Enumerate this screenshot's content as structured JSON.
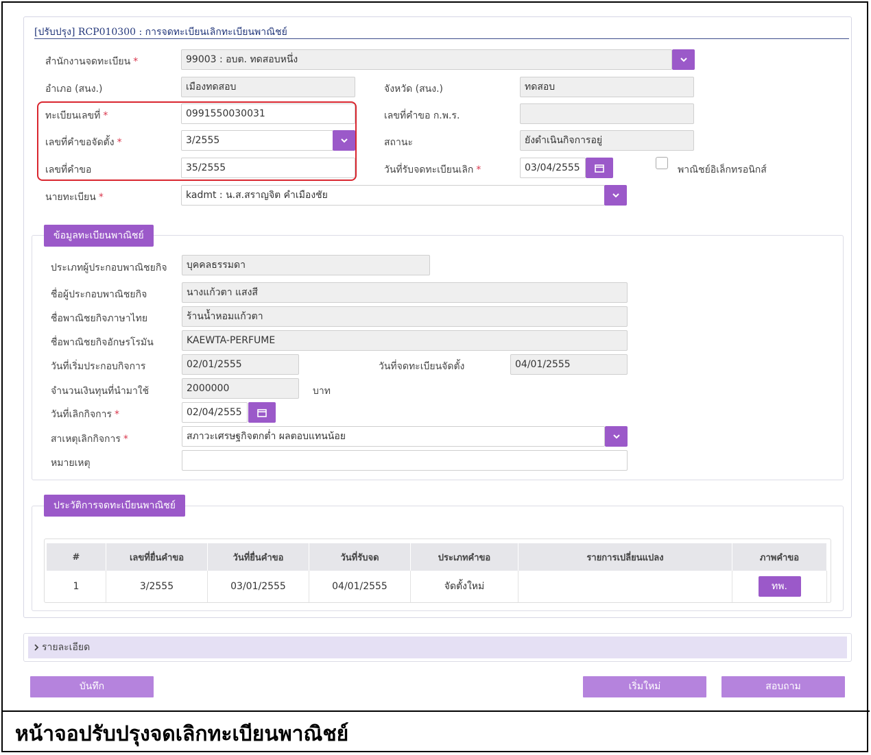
{
  "page": {
    "title": "[ปรับปรุง] RCP010300 : การจดทะเบียนเลิกทะเบียนพาณิชย์"
  },
  "form": {
    "office": {
      "label": "สำนักงานจดทะเบียน",
      "value": "99003 : อบต. ทดสอบหนึ่ง"
    },
    "district": {
      "label": "อำเภอ (สนง.)",
      "value": "เมืองทดสอบ"
    },
    "province": {
      "label": "จังหวัด (สนง.)",
      "value": "ทดสอบ"
    },
    "reg_no": {
      "label": "ทะเบียนเลขที่",
      "value": "0991550030031"
    },
    "request_no_pws": {
      "label": "เลขที่คำขอ ก.พ.ร.",
      "value": ""
    },
    "setup_request_no": {
      "label": "เลขที่คำขอจัดตั้ง",
      "value": "3/2555"
    },
    "status": {
      "label": "สถานะ",
      "value": "ยังดำเนินกิจการอยู่"
    },
    "request_no": {
      "label": "เลขที่คำขอ",
      "value": "35/2555"
    },
    "receive_date": {
      "label": "วันที่รับจดทะเบียนเลิก",
      "value": "03/04/2555"
    },
    "ecommerce": {
      "label": "พาณิชย์อิเล็กทรอนิกส์",
      "checked": false
    },
    "registrar": {
      "label": "นายทะเบียน",
      "value": "kadmt : น.ส.สราญจิต คำเมืองชัย"
    }
  },
  "commerce": {
    "heading": "ข้อมูลทะเบียนพาณิชย์",
    "operator_type": {
      "label": "ประเภทผู้ประกอบพาณิชยกิจ",
      "value": "บุคคลธรรมดา"
    },
    "operator_name": {
      "label": "ชื่อผู้ประกอบพาณิชยกิจ",
      "value": "นางแก้วตา แสงสี"
    },
    "name_th": {
      "label": "ชื่อพาณิชยกิจภาษาไทย",
      "value": "ร้านน้ำหอมแก้วตา"
    },
    "name_en": {
      "label": "ชื่อพาณิชยกิจอักษรโรมัน",
      "value": "KAEWTA-PERFUME"
    },
    "start_date": {
      "label": "วันที่เริ่มประกอบกิจการ",
      "value": "02/01/2555"
    },
    "setup_date": {
      "label": "วันที่จดทะเบียนจัดตั้ง",
      "value": "04/01/2555"
    },
    "capital": {
      "label": "จำนวนเงินทุนที่นำมาใช้",
      "value": "2000000",
      "unit": "บาท"
    },
    "close_date": {
      "label": "วันที่เลิกกิจการ",
      "value": "02/04/2555"
    },
    "reason": {
      "label": "สาเหตุเลิกกิจการ",
      "value": "สภาวะเศรษฐกิจตกต่ำ ผลตอบแทนน้อย"
    },
    "note": {
      "label": "หมายเหตุ",
      "value": ""
    }
  },
  "history": {
    "heading": "ประวัติการจดทะเบียนพาณิชย์",
    "columns": [
      "#",
      "เลขที่ยื่นคำขอ",
      "วันที่ยื่นคำขอ",
      "วันที่รับจด",
      "ประเภทคำขอ",
      "รายการเปลี่ยนแปลง",
      "ภาพคำขอ"
    ],
    "rows": [
      {
        "no": "1",
        "request_no": "3/2555",
        "submit_date": "03/01/2555",
        "receive_date": "04/01/2555",
        "type": "จัดตั้งใหม่",
        "changes": "",
        "image_button": "ทพ."
      }
    ]
  },
  "details": {
    "label": "รายละเอียด"
  },
  "buttons": {
    "save": "บันทึก",
    "reset": "เริ่มใหม่",
    "inquire": "สอบถาม"
  },
  "caption": "หน้าจอปรับปรุงจดเลิกทะเบียนพาณิชย์",
  "colors": {
    "accent": "#9b59c9",
    "required": "#d9364c",
    "highlight": "#d9252e"
  },
  "icons": {
    "dropdown": "chevron-down-icon",
    "calendar": "calendar-icon",
    "expand": "chevron-right-icon"
  }
}
